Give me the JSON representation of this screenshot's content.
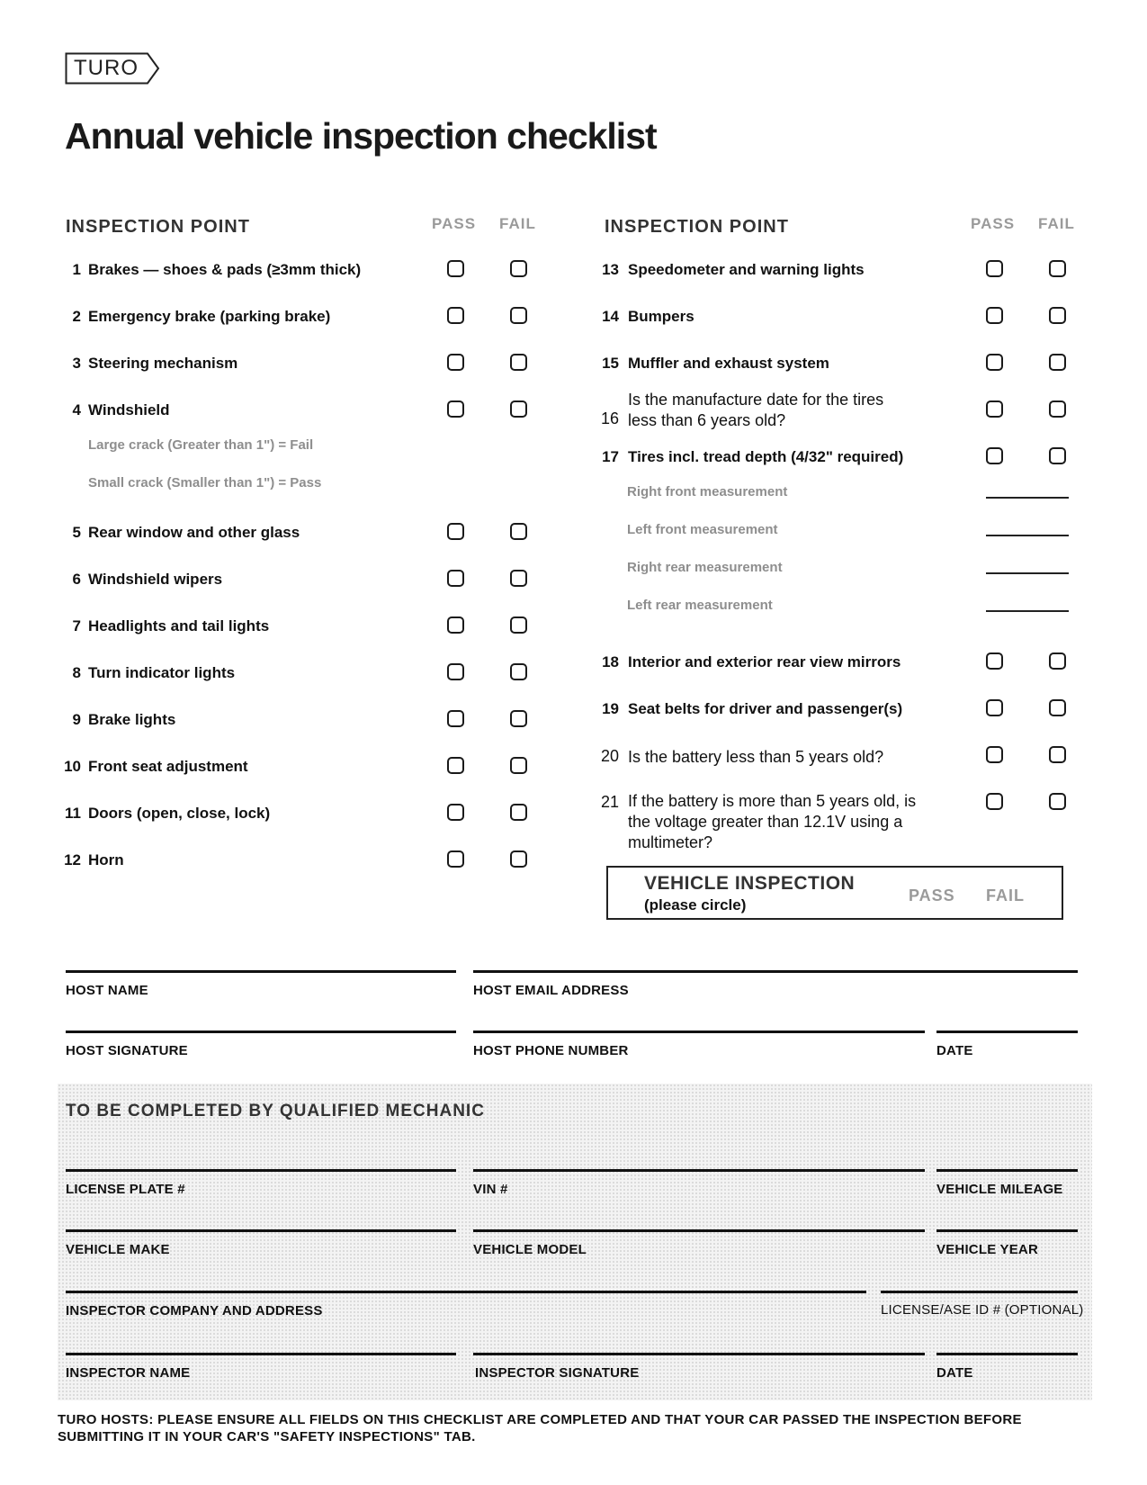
{
  "header": {
    "logo_text": "TURO",
    "title": "Annual vehicle inspection checklist"
  },
  "columns": {
    "header_label": "INSPECTION POINT",
    "pass_label": "PASS",
    "fail_label": "FAIL"
  },
  "left_items": [
    {
      "num": "1",
      "label": "Brakes — shoes & pads (≥3mm thick)"
    },
    {
      "num": "2",
      "label": "Emergency brake (parking brake)"
    },
    {
      "num": "3",
      "label": "Steering mechanism"
    },
    {
      "num": "4",
      "label": "Windshield",
      "notes": [
        "Large crack (Greater than 1\") = Fail",
        "Small crack (Smaller than 1\") = Pass"
      ]
    },
    {
      "num": "5",
      "label": "Rear window and other glass"
    },
    {
      "num": "6",
      "label": "Windshield wipers"
    },
    {
      "num": "7",
      "label": "Headlights and tail lights"
    },
    {
      "num": "8",
      "label": "Turn indicator lights"
    },
    {
      "num": "9",
      "label": "Brake lights"
    },
    {
      "num": "10",
      "label": "Front seat adjustment"
    },
    {
      "num": "11",
      "label": "Doors (open, close, lock)"
    },
    {
      "num": "12",
      "label": "Horn"
    }
  ],
  "right_items": [
    {
      "num": "13",
      "label": "Speedometer and warning lights"
    },
    {
      "num": "14",
      "label": "Bumpers"
    },
    {
      "num": "15",
      "label": "Muffler and exhaust system"
    },
    {
      "num": "16",
      "label": "Is the manufacture date for the tires less than 6 years old?"
    },
    {
      "num": "17",
      "label": "Tires incl. tread depth (4/32\" required)",
      "measurements": [
        "Right front measurement",
        "Left front measurement",
        "Right rear measurement",
        "Left rear measurement"
      ]
    },
    {
      "num": "18",
      "label": "Interior and exterior rear view mirrors"
    },
    {
      "num": "19",
      "label": "Seat belts for driver and passenger(s)"
    },
    {
      "num": "20",
      "label": "Is the battery less than 5 years old?"
    },
    {
      "num": "21",
      "label": "If the battery is more than 5 years old, is the voltage greater than 12.1V using a multimeter?"
    }
  ],
  "vehicle_inspection": {
    "title": "VEHICLE INSPECTION",
    "subtitle": "(please circle)",
    "pass": "PASS",
    "fail": "FAIL"
  },
  "host_fields": {
    "host_name": "HOST NAME",
    "host_email": "HOST EMAIL ADDRESS",
    "host_signature": "HOST SIGNATURE",
    "host_phone": "HOST PHONE NUMBER",
    "date": "DATE"
  },
  "mechanic": {
    "title": "TO BE COMPLETED BY QUALIFIED MECHANIC",
    "license_plate": "LICENSE PLATE #",
    "vin": "VIN #",
    "mileage": "VEHICLE MILEAGE",
    "make": "VEHICLE MAKE",
    "model": "VEHICLE MODEL",
    "year": "VEHICLE YEAR",
    "company": "INSPECTOR COMPANY AND ADDRESS",
    "license_ase": "LICENSE/ASE ID # (OPTIONAL)",
    "inspector_name": "INSPECTOR NAME",
    "inspector_signature": "INSPECTOR SIGNATURE",
    "date": "DATE"
  },
  "footer": {
    "note": "TURO HOSTS: PLEASE ENSURE ALL FIELDS ON THIS CHECKLIST ARE COMPLETED AND THAT YOUR CAR PASSED THE INSPECTION BEFORE SUBMITTING IT IN YOUR CAR'S \"SAFETY INSPECTIONS\" TAB."
  }
}
